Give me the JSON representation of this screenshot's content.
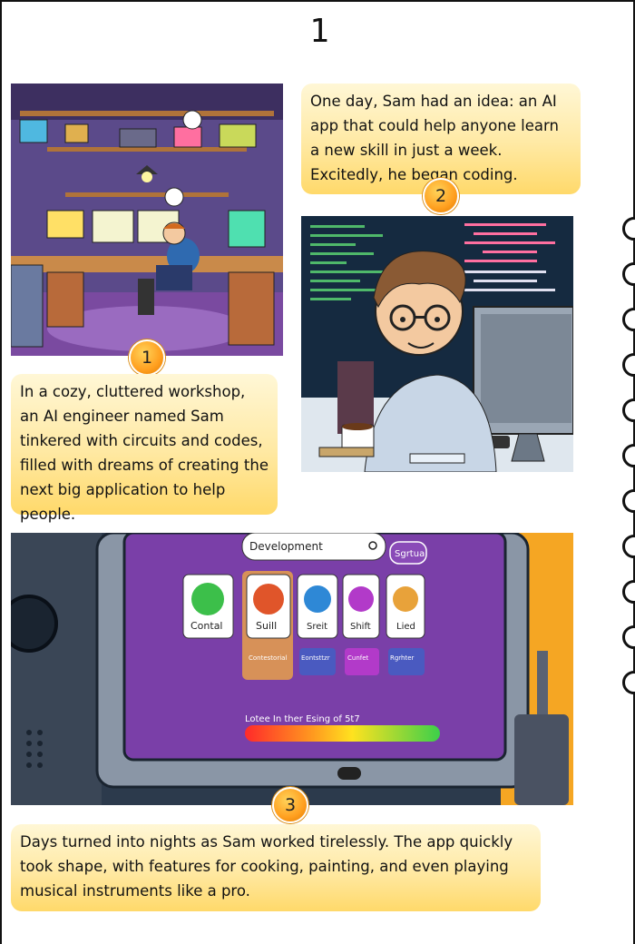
{
  "page": {
    "number": "1"
  },
  "panels": [
    {
      "id": 1,
      "badge": "1",
      "caption": "In a cozy, cluttered workshop, an AI engineer named Sam tinkered with circuits and codes, filled with dreams of creating the next big application to help people."
    },
    {
      "id": 2,
      "badge": "2",
      "caption": "One day, Sam had an idea: an AI app that could help anyone learn a new skill in just a week. Excitedly, he began coding."
    },
    {
      "id": 3,
      "badge": "3",
      "caption": "Days turned into nights as Sam worked tirelessly. The app quickly took shape, with features for cooking, painting, and even playing musical instruments like a pro.",
      "screen": {
        "search_text": "Development",
        "search_button": "Sgrtua",
        "apps": [
          {
            "label": "Contal",
            "sublabel": "",
            "color": "#3cbf4a"
          },
          {
            "label": "Suill",
            "sublabel": "Contestorial",
            "color": "#e0552a"
          },
          {
            "label": "Sreit",
            "sublabel": "Eontsttzr",
            "color": "#2e88d6"
          },
          {
            "label": "Shift",
            "sublabel": "Cunfet",
            "color": "#b23ac9"
          },
          {
            "label": "Lied",
            "sublabel": "Rgrhter",
            "color": "#e8a23a"
          }
        ],
        "progress_label": "Lotee In ther Esing of 5t7"
      }
    }
  ]
}
